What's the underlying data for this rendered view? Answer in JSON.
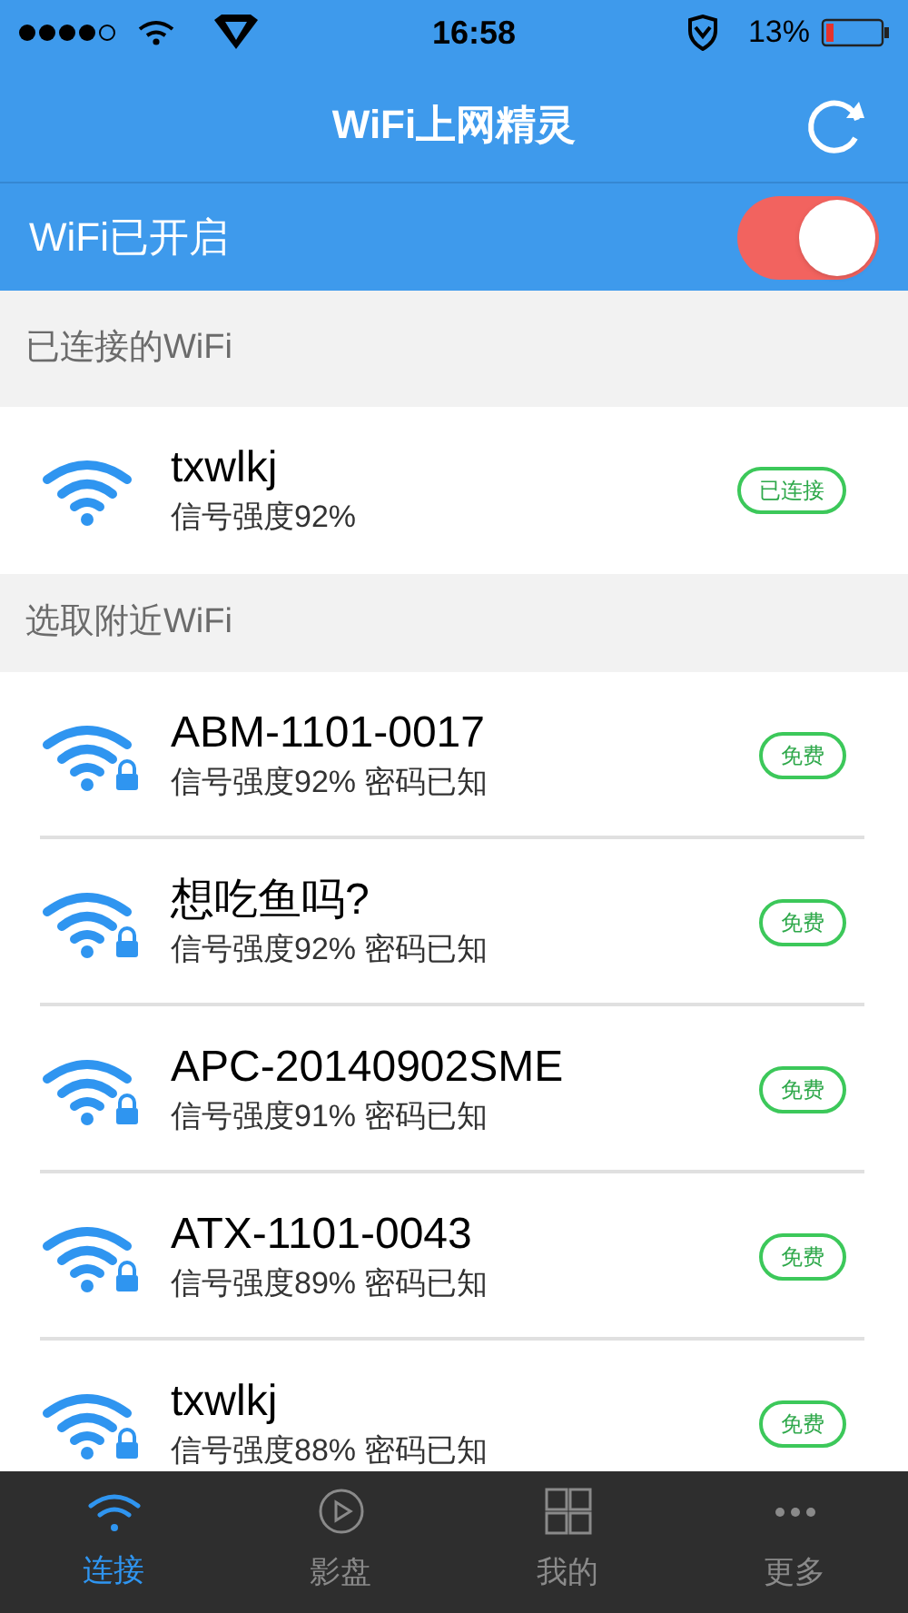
{
  "status_bar": {
    "time": "16:58",
    "battery": "13%"
  },
  "header": {
    "title": "WiFi上网精灵"
  },
  "wifi_toggle": {
    "label": "WiFi已开启",
    "on": true
  },
  "connected_section": {
    "title": "已连接的WiFi",
    "networks": [
      {
        "name": "txwlkj",
        "detail": "信号强度92%",
        "locked": false,
        "badge": "已连接"
      }
    ]
  },
  "nearby_section": {
    "title": "选取附近WiFi",
    "networks": [
      {
        "name": "ABM-1101-0017",
        "detail": "信号强度92% 密码已知",
        "locked": true,
        "badge": "免费"
      },
      {
        "name": "想吃鱼吗?",
        "detail": "信号强度92% 密码已知",
        "locked": true,
        "badge": "免费"
      },
      {
        "name": "APC-20140902SME",
        "detail": "信号强度91% 密码已知",
        "locked": true,
        "badge": "免费"
      },
      {
        "name": "ATX-1101-0043",
        "detail": "信号强度89% 密码已知",
        "locked": true,
        "badge": "免费"
      },
      {
        "name": "txwlkj",
        "detail": "信号强度88% 密码已知",
        "locked": true,
        "badge": "免费"
      }
    ]
  },
  "tab_bar": [
    {
      "label": "连接",
      "selected": true
    },
    {
      "label": "影盘",
      "selected": false
    },
    {
      "label": "我的",
      "selected": false
    },
    {
      "label": "更多",
      "selected": false
    }
  ]
}
